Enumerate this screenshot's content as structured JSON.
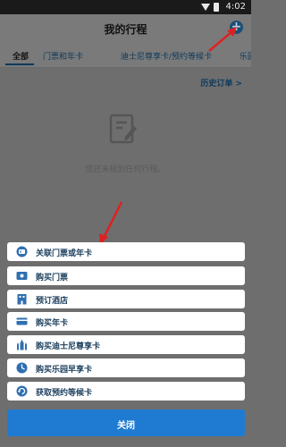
{
  "status_bar": {
    "time": "4:02"
  },
  "header": {
    "title": "我的行程",
    "add_symbol": "+"
  },
  "tabs": [
    {
      "label": "全部",
      "active": true
    },
    {
      "label": "门票和年卡"
    },
    {
      "label": "迪士尼尊享卡/预约等候卡"
    },
    {
      "label": "乐园"
    }
  ],
  "history_link": "历史订单 >",
  "empty_state": {
    "message": "您还未规划任何行程。",
    "icon": "edit-document-icon"
  },
  "menu": {
    "items": [
      {
        "label": "关联门票或年卡",
        "icon": "ticket-link-icon"
      },
      {
        "label": "购买门票",
        "icon": "ticket-icon"
      },
      {
        "label": "预订酒店",
        "icon": "hotel-icon"
      },
      {
        "label": "购买年卡",
        "icon": "annual-card-icon"
      },
      {
        "label": "购买迪士尼尊享卡",
        "icon": "castle-icon"
      },
      {
        "label": "购买乐园早享卡",
        "icon": "early-access-icon"
      },
      {
        "label": "获取预约等候卡",
        "icon": "return-time-icon"
      }
    ],
    "close_label": "关闭"
  },
  "colors": {
    "accent": "#1f7bd1",
    "overlay": "#6e6e6e",
    "arrow": "#e02020"
  }
}
